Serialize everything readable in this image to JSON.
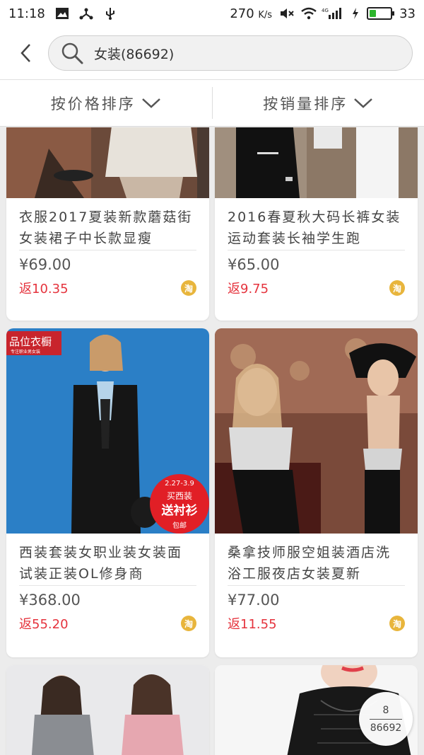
{
  "status_bar": {
    "time": "11:18",
    "network_speed": "270",
    "network_unit": "K/s",
    "battery": "33",
    "battery_level": 0.33,
    "signal": "4G"
  },
  "search": {
    "query": "女装(86692)"
  },
  "sort": {
    "by_price": "按价格排序",
    "by_sales": "按销量排序"
  },
  "products": [
    {
      "title": "衣服2017夏装新款蘑菇街女装裙子中长款显瘦",
      "price": "¥69.00",
      "rebate": "返10.35",
      "badge": "淘"
    },
    {
      "title": "2016春夏秋大码长裤女装运动套装长袖学生跑",
      "price": "¥65.00",
      "rebate": "返9.75",
      "badge": "淘"
    },
    {
      "title": "西装套装女职业装女装面试装正装OL修身商",
      "price": "¥368.00",
      "rebate": "返55.20",
      "badge": "淘",
      "image_text": {
        "brand": "品位衣橱",
        "tagline": "专注职业男女装",
        "date": "2.27-3.9",
        "promo1": "买西装",
        "promo2": "送衬衫",
        "promo3": "包邮"
      }
    },
    {
      "title": "桑拿技师服空姐装酒店洗浴工服夜店女装夏新",
      "price": "¥77.00",
      "rebate": "返11.55",
      "badge": "淘"
    }
  ],
  "page_indicator": {
    "current": "8",
    "total": "86692"
  },
  "colors": {
    "rebate": "#e5333d",
    "badge": "#e8b53c",
    "background": "#ececec"
  }
}
